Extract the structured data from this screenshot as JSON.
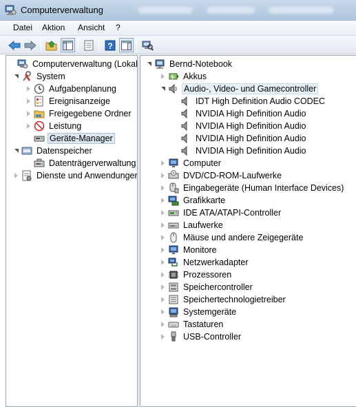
{
  "window": {
    "title": "Computerverwaltung"
  },
  "menu": {
    "items": [
      "Datei",
      "Aktion",
      "Ansicht",
      "?"
    ]
  },
  "left_tree": {
    "root": "Computerverwaltung (Lokal)",
    "system": "System",
    "aufgabenplanung": "Aufgabenplanung",
    "ereignisanzeige": "Ereignisanzeige",
    "freigegebene_ordner": "Freigegebene Ordner",
    "leistung": "Leistung",
    "geraete_manager": "Geräte-Manager",
    "datenspeicher": "Datenspeicher",
    "datentraegerverwaltung": "Datenträgerverwaltung",
    "dienste": "Dienste und Anwendungen"
  },
  "right_tree": {
    "root": "Bernd-Notebook",
    "categories": [
      "Akkus",
      "Audio-, Video- und Gamecontroller",
      "Computer",
      "DVD/CD-ROM-Laufwerke",
      "Eingabegeräte (Human Interface Devices)",
      "Grafikkarte",
      "IDE ATA/ATAPI-Controller",
      "Laufwerke",
      "Mäuse und andere Zeigegeräte",
      "Monitore",
      "Netzwerkadapter",
      "Prozessoren",
      "Speichercontroller",
      "Speichertechnologietreiber",
      "Systemgeräte",
      "Tastaturen",
      "USB-Controller"
    ],
    "audio_devices": [
      "IDT High Definition Audio CODEC",
      "NVIDIA High Definition Audio",
      "NVIDIA High Definition Audio",
      "NVIDIA High Definition Audio",
      "NVIDIA High Definition Audio"
    ]
  },
  "colors": {
    "selection_bg": "#dde8f3",
    "selection_border": "#a7c4e0",
    "titlebar": "#b7cde3"
  }
}
